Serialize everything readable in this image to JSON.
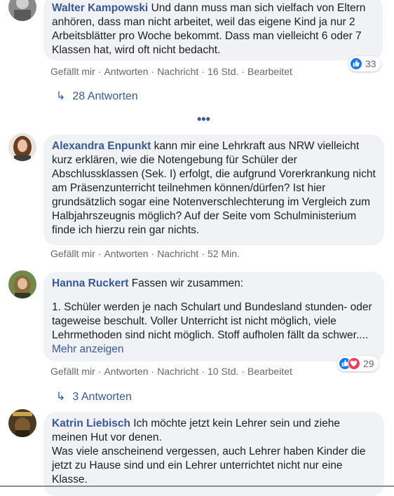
{
  "labels": {
    "like": "Gefällt mir",
    "reply": "Antworten",
    "message": "Nachricht",
    "edit": "Bearbeitet",
    "dot": "·"
  },
  "comments": [
    {
      "author": "Walter Kampowski",
      "text": "Und dann muss man sich vielfach von Eltern anhören, dass man nicht arbeitet, weil das eigene Kind ja nur 2 Arbeitsblätter pro Woche bekommt. Dass man vielleicht 6 oder 7 Klassen hat, wird oft nicht bedacht.",
      "time": "16 Std.",
      "reactions": "33",
      "replies": "28 Antworten"
    },
    {
      "author": "Alexandra Enpunkt",
      "text": "kann mir eine Lehrkraft aus NRW vielleicht kurz erklären, wie die Notengebung für Schüler der Abschlussklassen (Sek. I) erfolgt, die aufgrund Vorerkrankung nicht am Präsenzunterricht teilnehmen können/dürfen? Ist hier grundsätzlich sogar eine Notenverschlechterung im Vergleich zum Halbjahrszeugnis möglich? Auf der Seite vom Schulministerium finde ich hierzu rein gar nichts.",
      "time": "52 Min."
    },
    {
      "author": "Hanna Ruckert",
      "text": "Fassen wir zusammen:",
      "text2": "1. Schüler werden je nach Schulart und Bundesland stunden- oder tageweise beschult. Voller Unterricht ist nicht möglich, viele Lehrmethoden sind nicht möglich. Stoff aufholen fällt da schwer....",
      "see_more": "Mehr anzeigen",
      "time": "10 Std.",
      "reactions": "29",
      "replies": "3 Antworten"
    },
    {
      "author": "Katrin Liebisch",
      "text": "Ich möchte jetzt kein Lehrer sein und ziehe meinen Hut vor denen.",
      "text2": "Was viele anscheinend vergessen, auch Lehrer haben Kinder die jetzt zu Hause sind und ein Lehrer unterrichtet nicht nur eine Klasse."
    }
  ],
  "more_indicator": "•••",
  "icons": {
    "reply_arrow": "reply-arrow-icon",
    "like": "like-reaction-icon",
    "love": "love-reaction-icon"
  },
  "colors": {
    "link": "#385898",
    "bubble": "#f0f2f5",
    "meta": "#65676b",
    "like": "#1877f2",
    "love": "#f33e58"
  }
}
